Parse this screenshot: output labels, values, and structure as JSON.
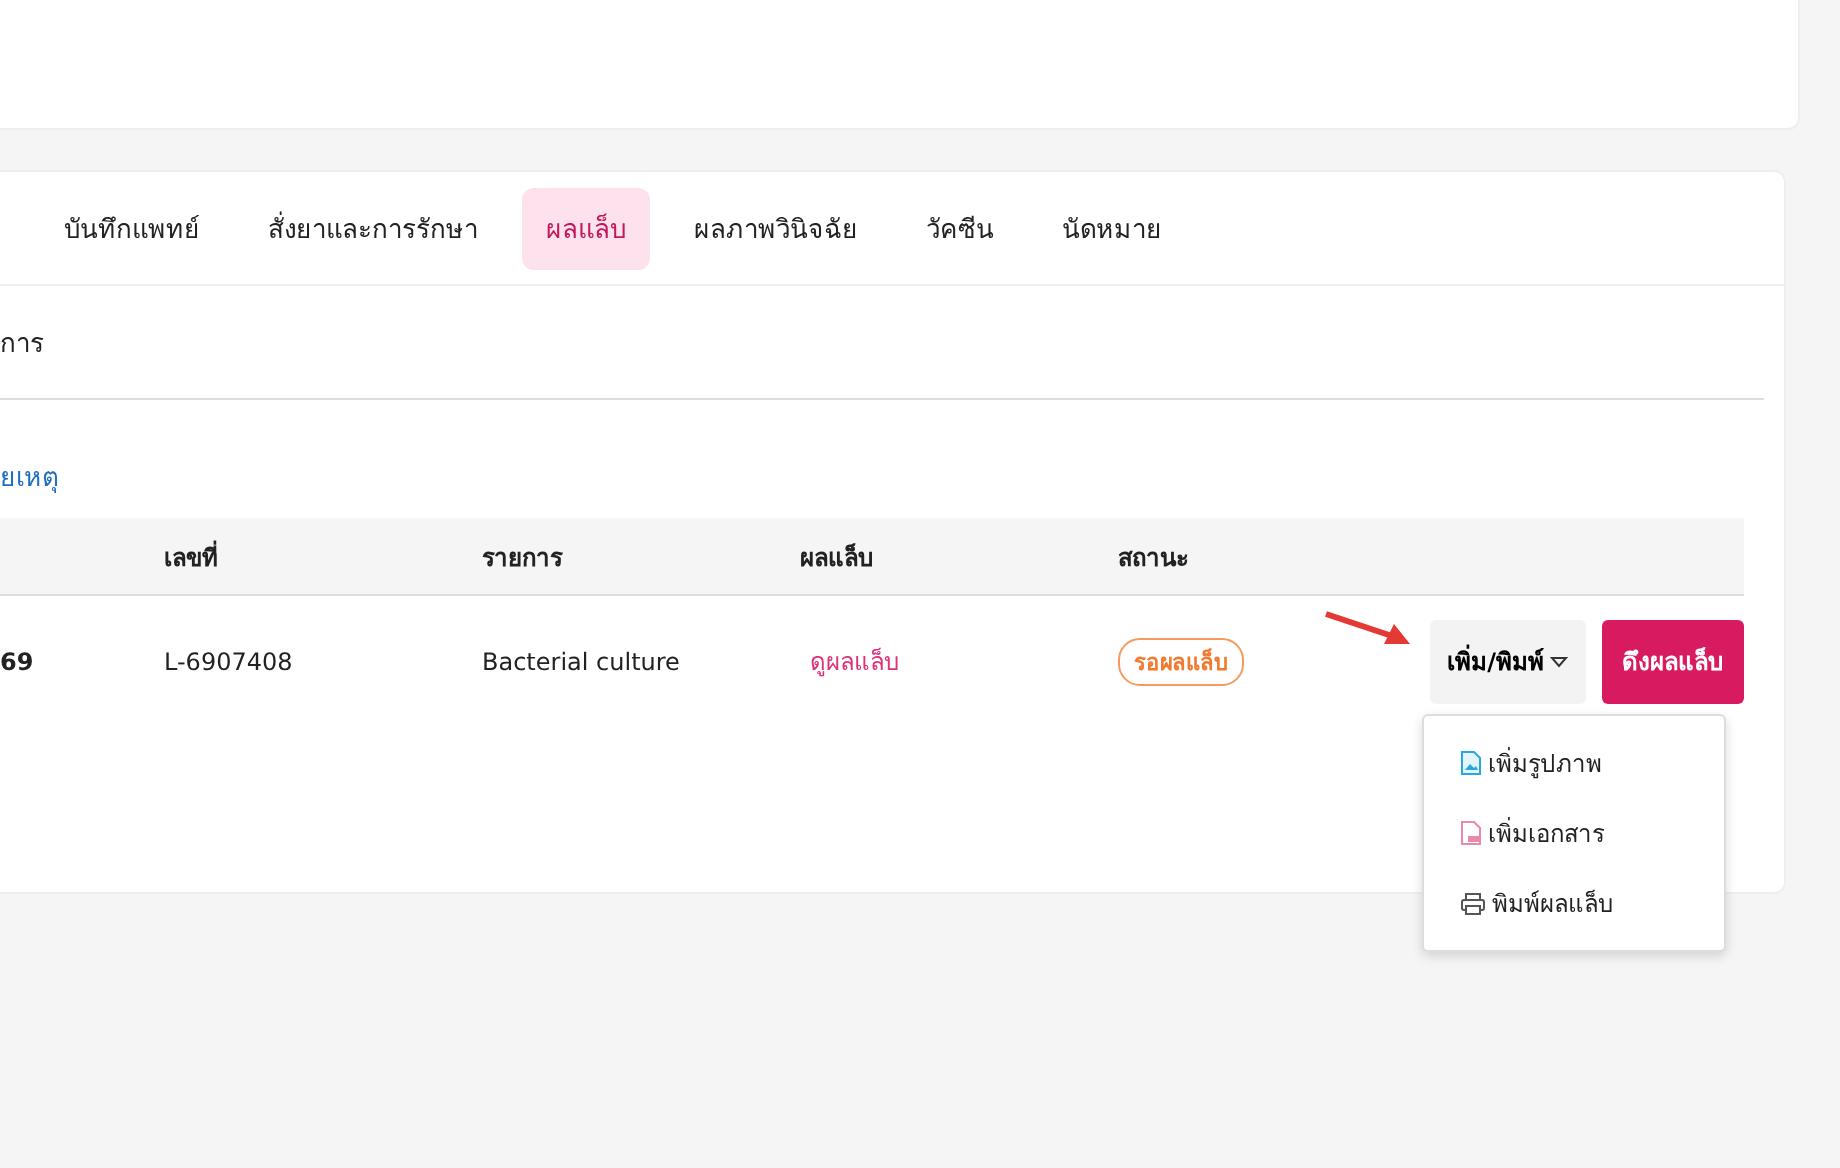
{
  "tabs": [
    {
      "label": "บันทึกแพทย์",
      "selected": false
    },
    {
      "label": "สั่งยาและการรักษา",
      "selected": false
    },
    {
      "label": "ผลแล็บ",
      "selected": true
    },
    {
      "label": "ผลภาพวินิจฉัย",
      "selected": false
    },
    {
      "label": "วัคซีน",
      "selected": false
    },
    {
      "label": "นัดหมาย",
      "selected": false
    }
  ],
  "section_title": "การ",
  "note_link": "ยเหตุ",
  "table": {
    "columns": [
      "",
      "เลขที่",
      "รายการ",
      "ผลแล็บ",
      "สถานะ"
    ],
    "rows": [
      {
        "column_1": "69",
        "number": "L-6907408",
        "item": "Bacterial culture",
        "result_link": "ดูผลแล็บ",
        "status": "รอผลแล็บ",
        "add_print_button": "เพิ่ม/พิมพ์",
        "fetch_button": "ดึงผลแล็บ"
      }
    ]
  },
  "dropdown_menu": {
    "open": true,
    "items": [
      {
        "kind": "image",
        "label": "เพิ่มรูปภาพ"
      },
      {
        "kind": "document",
        "label": "เพิ่มเอกสาร"
      },
      {
        "kind": "print",
        "label": "พิมพ์ผลแล็บ"
      }
    ]
  }
}
